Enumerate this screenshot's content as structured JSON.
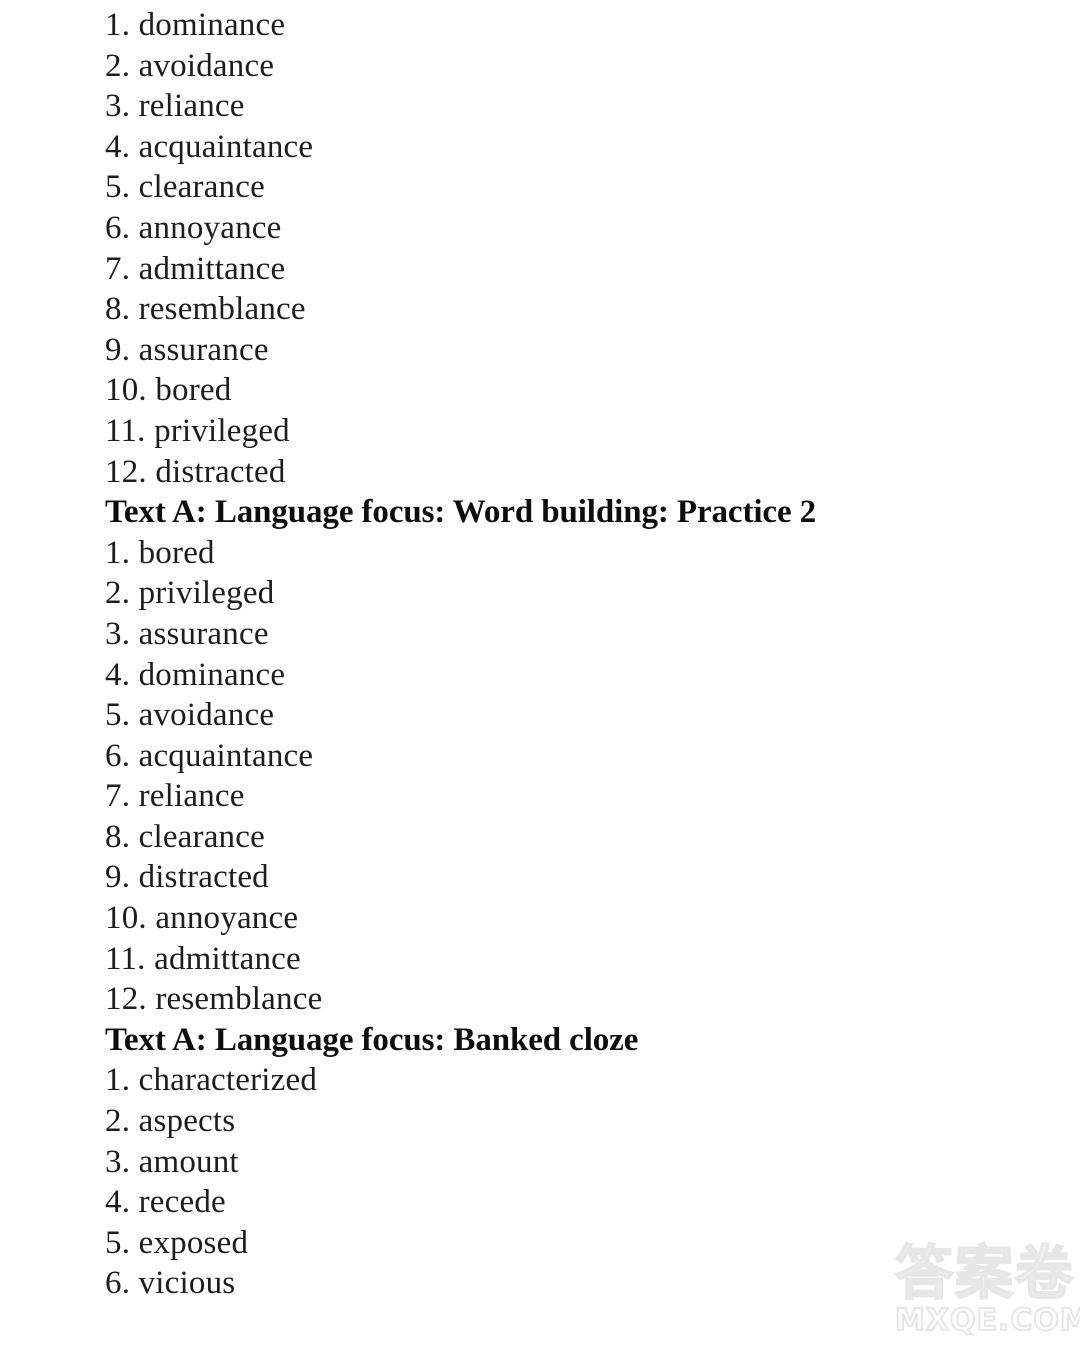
{
  "page": {
    "background_color": "#ffffff",
    "text_color": "#1d1d1a",
    "heading_color": "#0d0d0d"
  },
  "sections": [
    {
      "heading": null,
      "items": [
        {
          "num": "1.",
          "word": "dominance"
        },
        {
          "num": "2.",
          "word": "avoidance"
        },
        {
          "num": "3.",
          "word": "reliance"
        },
        {
          "num": "4.",
          "word": "acquaintance"
        },
        {
          "num": "5.",
          "word": "clearance"
        },
        {
          "num": "6.",
          "word": "annoyance"
        },
        {
          "num": "7.",
          "word": "admittance"
        },
        {
          "num": "8.",
          "word": "resemblance"
        },
        {
          "num": "9.",
          "word": "assurance"
        },
        {
          "num": "10.",
          "word": "bored"
        },
        {
          "num": "11.",
          "word": "privileged"
        },
        {
          "num": "12.",
          "word": "distracted"
        }
      ]
    },
    {
      "heading": "Text A: Language focus: Word building: Practice 2",
      "items": [
        {
          "num": "1.",
          "word": "bored"
        },
        {
          "num": "2.",
          "word": "privileged"
        },
        {
          "num": "3.",
          "word": "assurance"
        },
        {
          "num": "4.",
          "word": "dominance"
        },
        {
          "num": "5.",
          "word": "avoidance"
        },
        {
          "num": "6.",
          "word": "acquaintance"
        },
        {
          "num": "7.",
          "word": "reliance"
        },
        {
          "num": "8.",
          "word": "clearance"
        },
        {
          "num": "9.",
          "word": "distracted"
        },
        {
          "num": "10.",
          "word": "annoyance"
        },
        {
          "num": "11.",
          "word": "admittance"
        },
        {
          "num": "12.",
          "word": "resemblance"
        }
      ]
    },
    {
      "heading": "Text A: Language focus: Banked cloze",
      "items": [
        {
          "num": "1.",
          "word": "characterized"
        },
        {
          "num": "2.",
          "word": "aspects"
        },
        {
          "num": "3.",
          "word": "amount"
        },
        {
          "num": "4.",
          "word": "recede"
        },
        {
          "num": "5.",
          "word": "exposed"
        },
        {
          "num": "6.",
          "word": "vicious"
        }
      ]
    }
  ],
  "watermark": {
    "cjk_text": "答案",
    "circled_char": "卷",
    "domain_text": "MXQE.COM",
    "outline_color": "#e6e6e6"
  }
}
